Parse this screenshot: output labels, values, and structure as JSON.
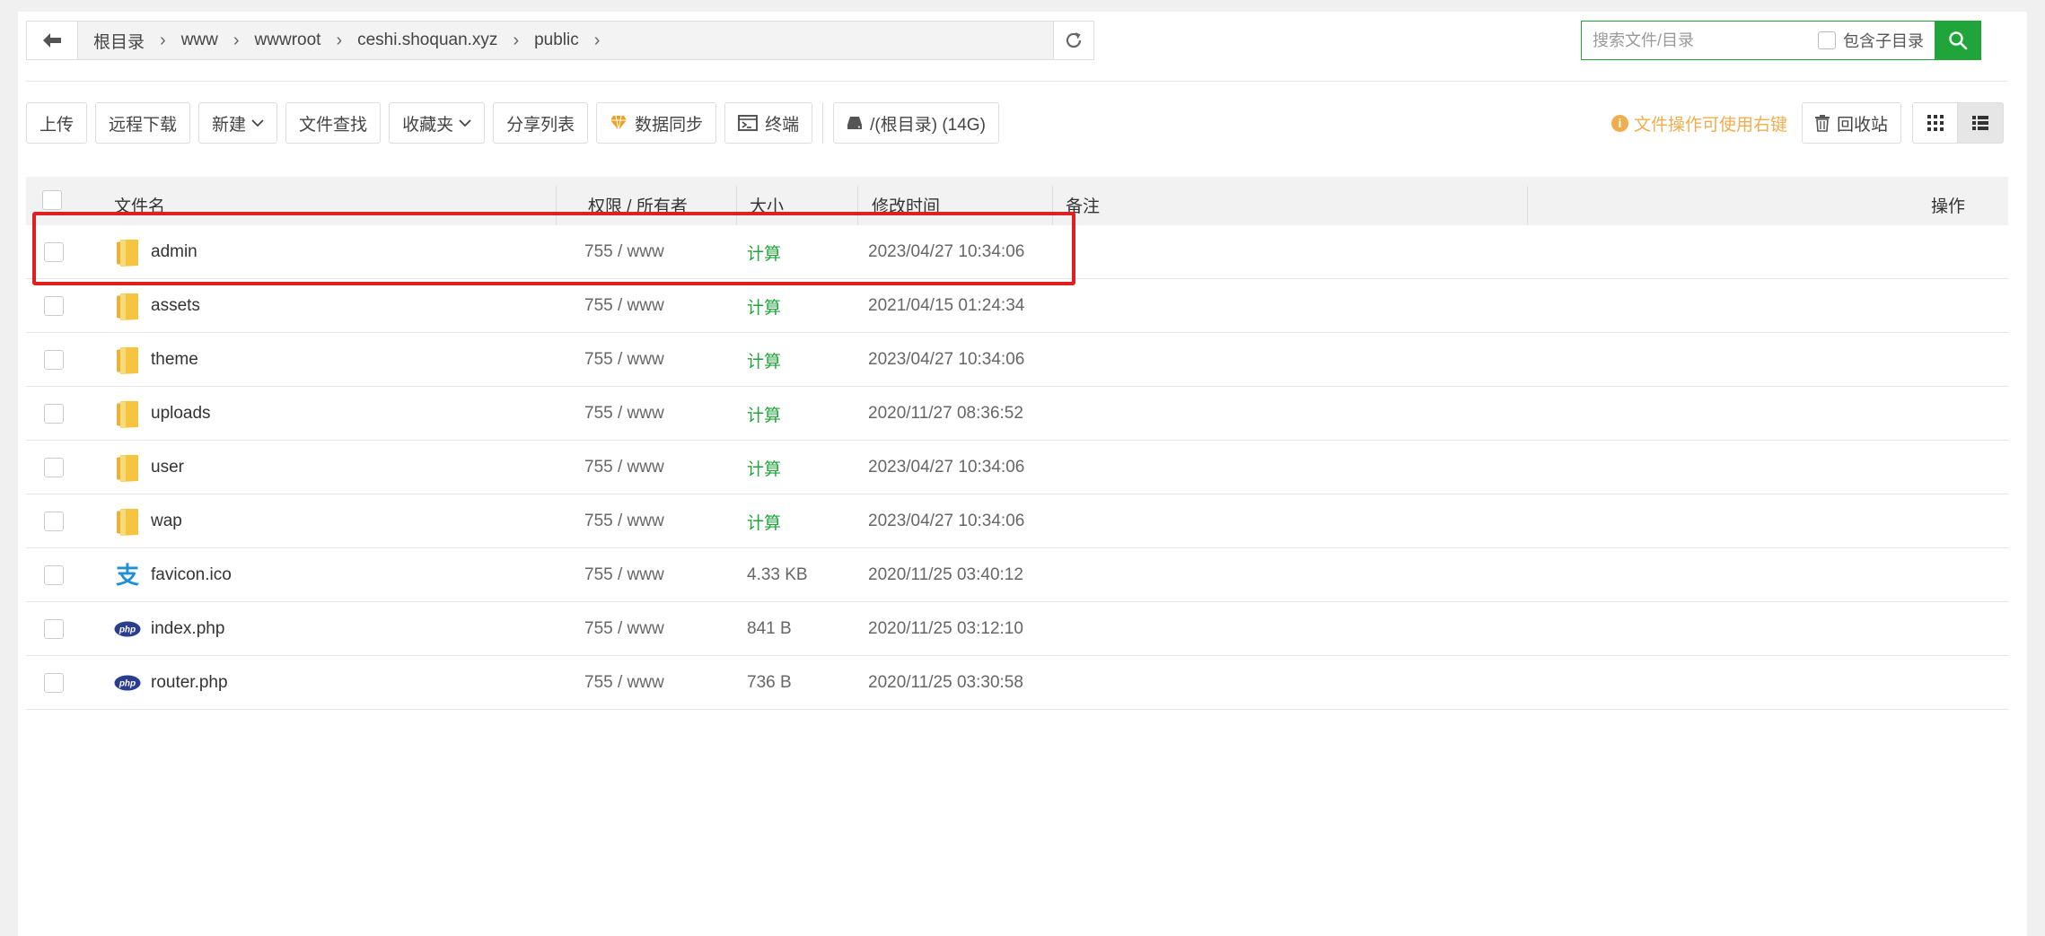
{
  "path": {
    "crumbs": [
      "根目录",
      "www",
      "wwwroot",
      "ceshi.shoquan.xyz",
      "public"
    ]
  },
  "search": {
    "placeholder": "搜索文件/目录",
    "include_sub_label": "包含子目录"
  },
  "toolbar": {
    "upload": "上传",
    "remote_download": "远程下载",
    "new": "新建",
    "file_search": "文件查找",
    "favorites": "收藏夹",
    "share_list": "分享列表",
    "data_sync": "数据同步",
    "terminal": "终端",
    "disk": "/(根目录) (14G)",
    "hint": "文件操作可使用右键",
    "recycle": "回收站"
  },
  "table": {
    "headers": {
      "name": "文件名",
      "perm": "权限 / 所有者",
      "size": "大小",
      "mtime": "修改时间",
      "remark": "备注",
      "action": "操作"
    },
    "rows": [
      {
        "name": "admin",
        "type": "folder",
        "perm": "755 / www",
        "size": "计算",
        "mtime": "2023/04/27 10:34:06"
      },
      {
        "name": "assets",
        "type": "folder",
        "perm": "755 / www",
        "size": "计算",
        "mtime": "2021/04/15 01:24:34"
      },
      {
        "name": "theme",
        "type": "folder",
        "perm": "755 / www",
        "size": "计算",
        "mtime": "2023/04/27 10:34:06"
      },
      {
        "name": "uploads",
        "type": "folder",
        "perm": "755 / www",
        "size": "计算",
        "mtime": "2020/11/27 08:36:52"
      },
      {
        "name": "user",
        "type": "folder",
        "perm": "755 / www",
        "size": "计算",
        "mtime": "2023/04/27 10:34:06"
      },
      {
        "name": "wap",
        "type": "folder",
        "perm": "755 / www",
        "size": "计算",
        "mtime": "2023/04/27 10:34:06"
      },
      {
        "name": "favicon.ico",
        "type": "ico",
        "perm": "755 / www",
        "size": "4.33 KB",
        "mtime": "2020/11/25 03:40:12"
      },
      {
        "name": "index.php",
        "type": "php",
        "perm": "755 / www",
        "size": "841 B",
        "mtime": "2020/11/25 03:12:10"
      },
      {
        "name": "router.php",
        "type": "php",
        "perm": "755 / www",
        "size": "736 B",
        "mtime": "2020/11/25 03:30:58"
      }
    ]
  },
  "icons": {
    "php_label": "php"
  },
  "colors": {
    "accent_green": "#20a53a",
    "hint_orange": "#f0ad4e",
    "highlight_red": "#e02020",
    "folder_yellow": "#f5c542"
  }
}
